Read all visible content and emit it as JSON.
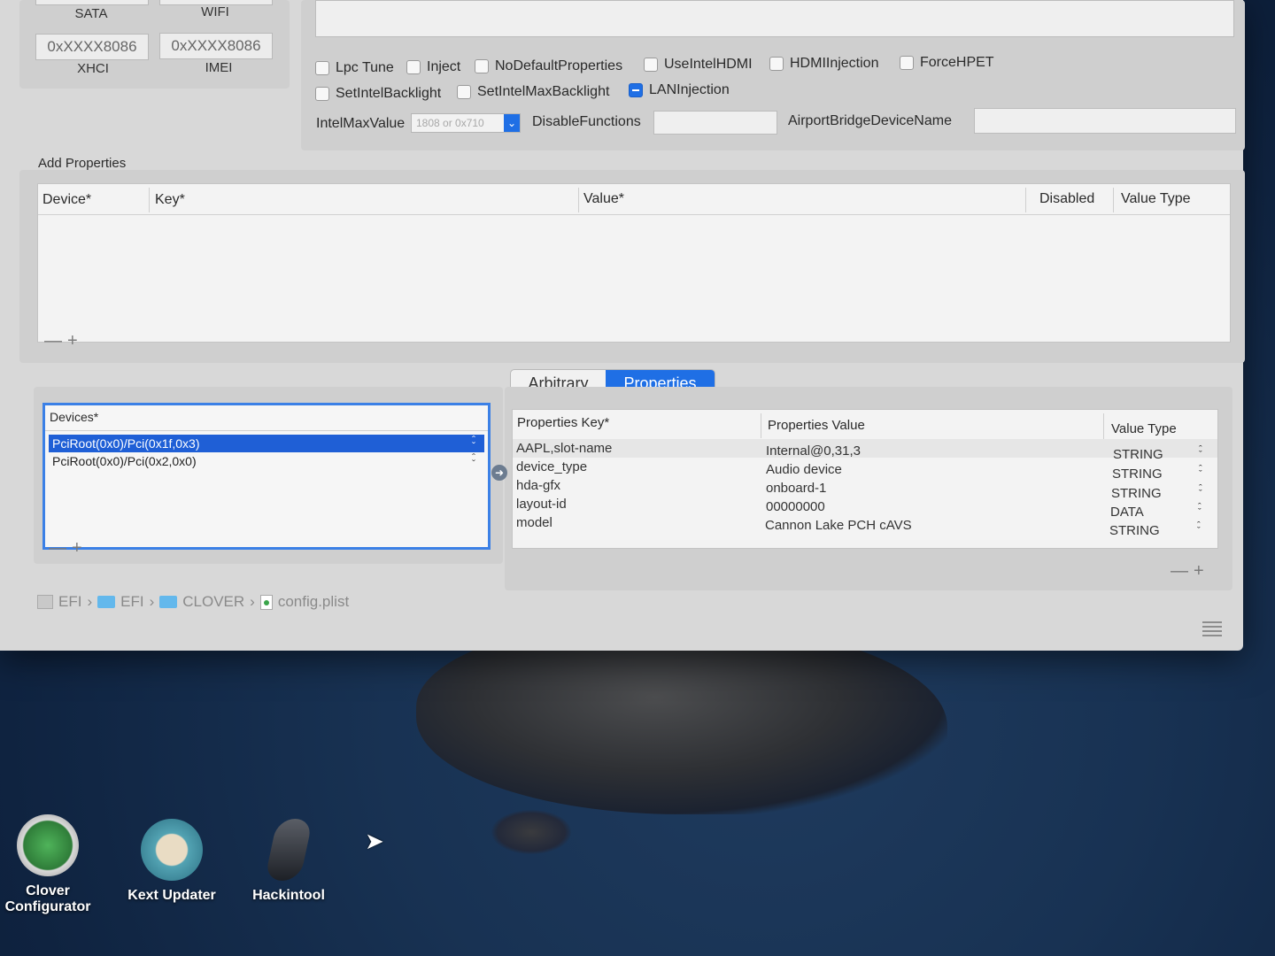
{
  "top_ids": [
    {
      "label": "SATA"
    },
    {
      "label": "WIFI"
    },
    {
      "value": "0xXXXX8086",
      "label": "XHCI"
    },
    {
      "value": "0xXXXX8086",
      "label": "IMEI"
    }
  ],
  "checkboxes_row1": [
    {
      "label": "Lpc Tune",
      "checked": false
    },
    {
      "label": "Inject",
      "checked": false
    },
    {
      "label": "NoDefaultProperties",
      "checked": false
    },
    {
      "label": "UseIntelHDMI",
      "checked": false
    },
    {
      "label": "HDMIInjection",
      "checked": false
    },
    {
      "label": "ForceHPET",
      "checked": false
    }
  ],
  "checkboxes_row2": [
    {
      "label": "SetIntelBacklight",
      "checked": false
    },
    {
      "label": "SetIntelMaxBacklight",
      "checked": false
    },
    {
      "label": "LANInjection",
      "checked": true
    }
  ],
  "intel_max_value": {
    "label": "IntelMaxValue",
    "placeholder": "1808 or 0x710"
  },
  "disable_functions": {
    "label": "DisableFunctions",
    "value": ""
  },
  "airport_bridge": {
    "label": "AirportBridgeDeviceName",
    "value": ""
  },
  "add_properties": {
    "title": "Add Properties",
    "columns": [
      "Device*",
      "Key*",
      "Value*",
      "Disabled",
      "Value Type"
    ],
    "rows": []
  },
  "add_controls": {
    "minus": "—",
    "plus": "+"
  },
  "tabs": {
    "arbitrary": "Arbitrary",
    "properties": "Properties",
    "selected": "Properties"
  },
  "devices": {
    "header": "Devices*",
    "items": [
      "PciRoot(0x0)/Pci(0x1f,0x3)",
      "PciRoot(0x0)/Pci(0x2,0x0)"
    ],
    "selected": 0
  },
  "properties": {
    "columns": [
      "Properties Key*",
      "Properties Value",
      "Value Type"
    ],
    "rows": [
      {
        "key": "AAPL,slot-name",
        "value": "Internal@0,31,3",
        "type": "STRING"
      },
      {
        "key": "device_type",
        "value": "Audio device",
        "type": "STRING"
      },
      {
        "key": "hda-gfx",
        "value": "onboard-1",
        "type": "STRING"
      },
      {
        "key": "layout-id",
        "value": "00000000",
        "type": "DATA"
      },
      {
        "key": "model",
        "value": "Cannon Lake PCH cAVS",
        "type": "STRING"
      }
    ]
  },
  "breadcrumb": [
    "EFI",
    "EFI",
    "CLOVER",
    "config.plist"
  ],
  "dock": [
    {
      "label": "Clover Configurator",
      "icon": "clover-icon"
    },
    {
      "label": "Kext Updater",
      "icon": "kext-updater-icon"
    },
    {
      "label": "Hackintool",
      "icon": "hackintool-icon"
    }
  ],
  "colors": {
    "accent": "#1f6fe5",
    "window_bg": "#d8d8d8"
  }
}
